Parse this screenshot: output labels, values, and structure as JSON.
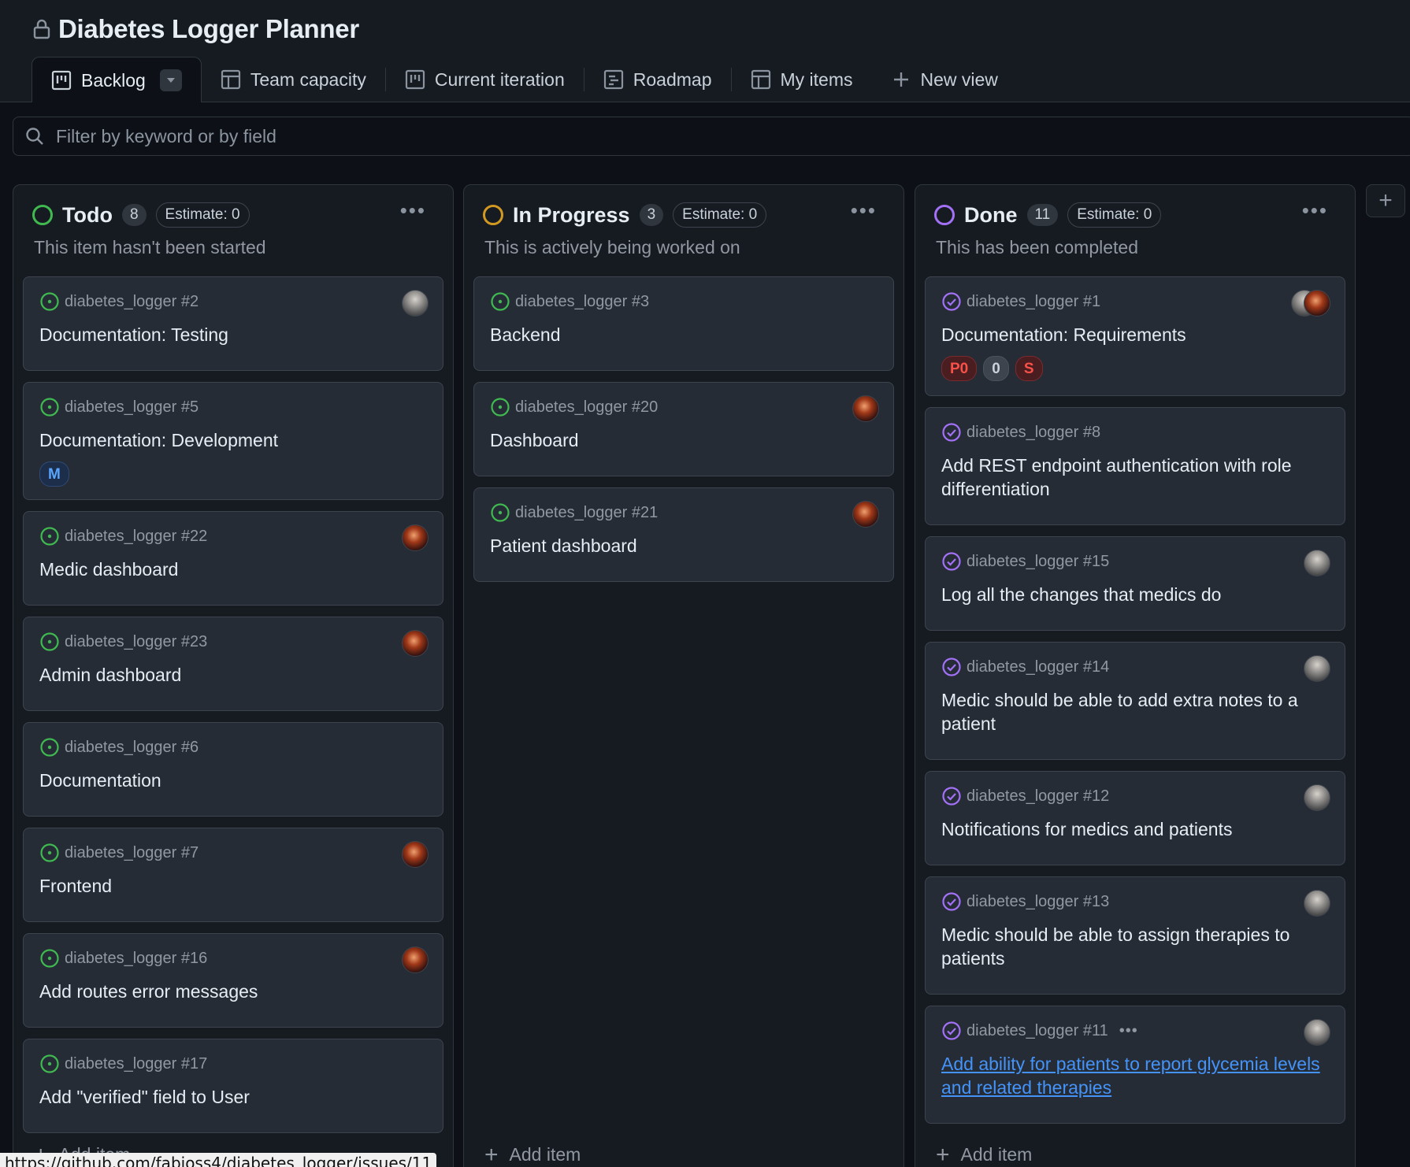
{
  "app": {
    "title": "Diabetes Logger Planner"
  },
  "tabs": [
    {
      "label": "Backlog",
      "icon": "board-icon"
    },
    {
      "label": "Team capacity",
      "icon": "table-icon"
    },
    {
      "label": "Current iteration",
      "icon": "board-icon"
    },
    {
      "label": "Roadmap",
      "icon": "roadmap-icon"
    },
    {
      "label": "My items",
      "icon": "table-icon"
    },
    {
      "label": "New view",
      "icon": "plus-icon"
    }
  ],
  "filter": {
    "placeholder": "Filter by keyword or by field"
  },
  "colors": {
    "todo": "#3fb950",
    "in_progress": "#d29922",
    "done": "#a371f7",
    "open_issue": "#3fb950",
    "closed_issue": "#a371f7",
    "link": "#4493f8"
  },
  "columns": [
    {
      "name": "Todo",
      "count": "8",
      "estimate": "Estimate: 0",
      "description": "This item hasn't been started",
      "add_item": "Add item",
      "cards": [
        {
          "ref": "diabetes_logger #2",
          "title": "Documentation: Testing",
          "avatar": "gray"
        },
        {
          "ref": "diabetes_logger #5",
          "title": "Documentation: Development",
          "labels": [
            "M"
          ]
        },
        {
          "ref": "diabetes_logger #22",
          "title": "Medic dashboard",
          "avatar": "red"
        },
        {
          "ref": "diabetes_logger #23",
          "title": "Admin dashboard",
          "avatar": "red"
        },
        {
          "ref": "diabetes_logger #6",
          "title": "Documentation"
        },
        {
          "ref": "diabetes_logger #7",
          "title": "Frontend",
          "avatar": "red"
        },
        {
          "ref": "diabetes_logger #16",
          "title": "Add routes error messages",
          "avatar": "red"
        },
        {
          "ref": "diabetes_logger #17",
          "title": "Add \"verified\" field to User"
        }
      ]
    },
    {
      "name": "In Progress",
      "count": "3",
      "estimate": "Estimate: 0",
      "description": "This is actively being worked on",
      "add_item": "Add item",
      "cards": [
        {
          "ref": "diabetes_logger #3",
          "title": "Backend"
        },
        {
          "ref": "diabetes_logger #20",
          "title": "Dashboard",
          "avatar": "red"
        },
        {
          "ref": "diabetes_logger #21",
          "title": "Patient dashboard",
          "avatar": "red"
        }
      ]
    },
    {
      "name": "Done",
      "count": "11",
      "estimate": "Estimate: 0",
      "description": "This has been completed",
      "add_item": "Add item",
      "cards": [
        {
          "ref": "diabetes_logger #1",
          "title": "Documentation: Requirements",
          "avatars": [
            "gray",
            "red"
          ],
          "labels": [
            "P0",
            "0",
            "S"
          ]
        },
        {
          "ref": "diabetes_logger #8",
          "title": "Add REST endpoint authentication with role differentiation"
        },
        {
          "ref": "diabetes_logger #15",
          "title": "Log all the changes that medics do",
          "avatar": "gray"
        },
        {
          "ref": "diabetes_logger #14",
          "title": "Medic should be able to add extra notes to a patient",
          "avatar": "gray"
        },
        {
          "ref": "diabetes_logger #12",
          "title": "Notifications for medics and patients",
          "avatar": "gray"
        },
        {
          "ref": "diabetes_logger #13",
          "title": "Medic should be able to assign therapies to patients",
          "avatar": "gray"
        },
        {
          "ref": "diabetes_logger #11",
          "title": "Add ability for patients to report glycemia levels and related therapies",
          "avatar": "gray",
          "more": "•••"
        }
      ]
    }
  ],
  "status_bar": {
    "url": "https://github.com/fabioss4/diabetes_logger/issues/11"
  }
}
